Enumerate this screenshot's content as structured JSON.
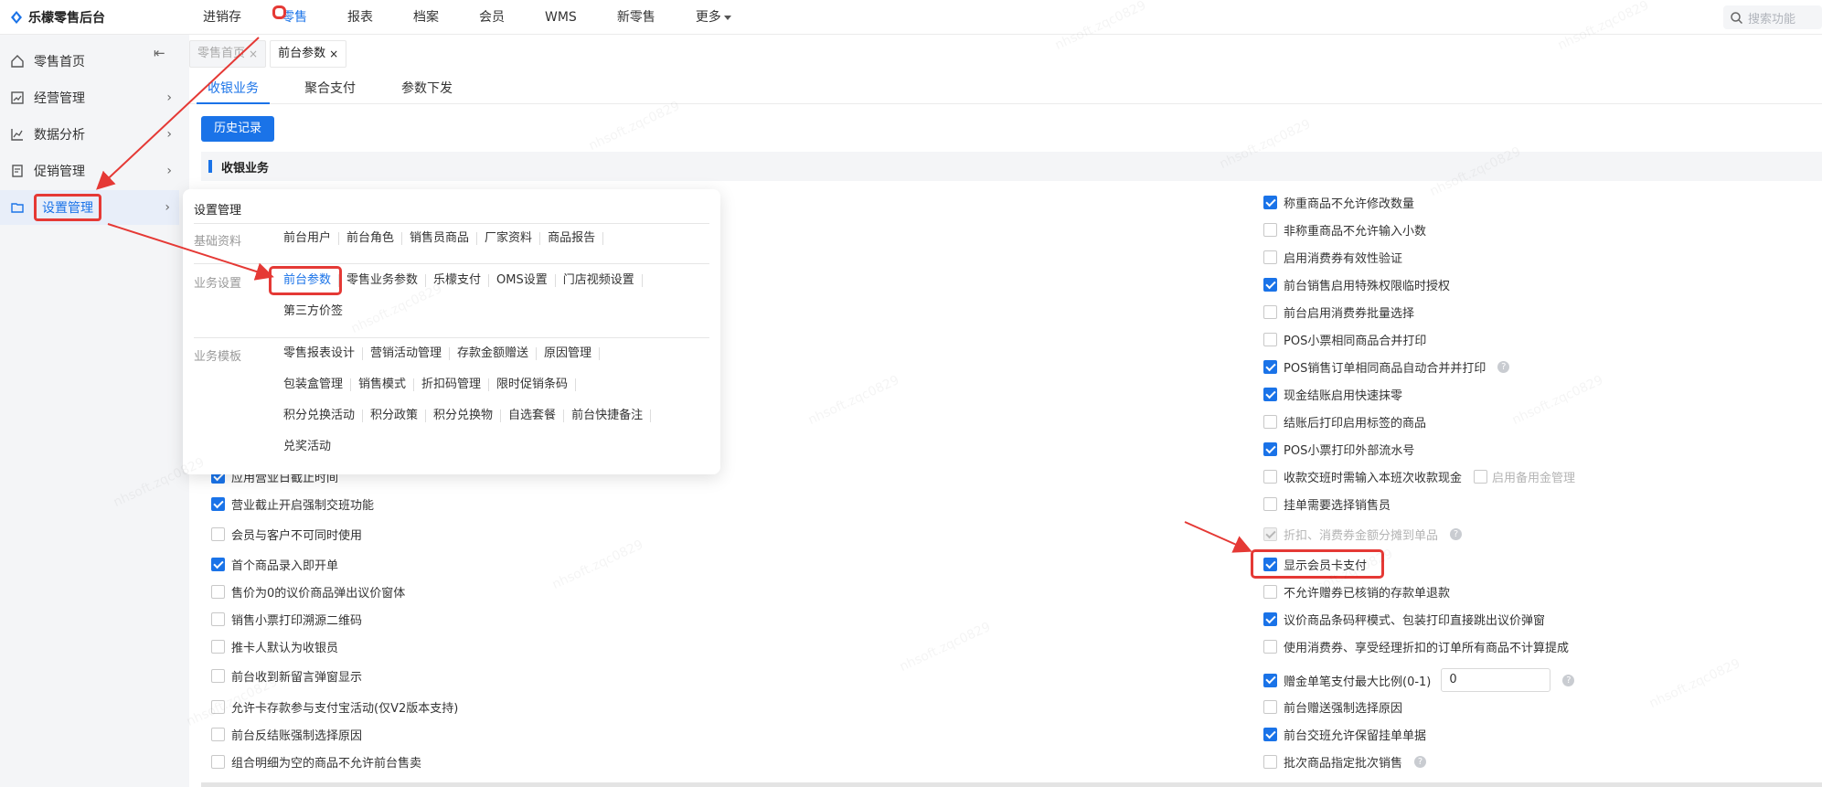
{
  "app": {
    "name": "乐檬零售后台",
    "accent": "#1a73e8",
    "highlight": "#e53935"
  },
  "topnav": {
    "items": [
      "进销存",
      "零售",
      "报表",
      "档案",
      "会员",
      "WMS",
      "新零售",
      "更多"
    ],
    "active_index": 1
  },
  "search": {
    "placeholder": "搜索功能"
  },
  "sidebar": {
    "collapse_glyph": "⇤",
    "items": [
      {
        "label": "零售首页",
        "icon": "home-icon"
      },
      {
        "label": "经营管理",
        "icon": "chart-box-icon"
      },
      {
        "label": "数据分析",
        "icon": "trend-icon"
      },
      {
        "label": "促销管理",
        "icon": "tag-icon"
      },
      {
        "label": "设置管理",
        "icon": "folder-icon"
      }
    ],
    "active_index": 4
  },
  "tabs": [
    {
      "label": "零售首页",
      "active": false
    },
    {
      "label": "前台参数",
      "active": true
    }
  ],
  "subtabs": {
    "items": [
      "收银业务",
      "聚合支付",
      "参数下发"
    ],
    "active_index": 0
  },
  "history_button": "历史记录",
  "section_title": "收银业务",
  "dropdown": {
    "title": "设置管理",
    "groups": [
      {
        "category": "基础资料",
        "rows": [
          [
            "前台用户",
            "前台角色",
            "销售员商品",
            "厂家资料",
            "商品报告"
          ]
        ]
      },
      {
        "category": "业务设置",
        "rows": [
          [
            "前台参数",
            "零售业务参数",
            "乐檬支付",
            "OMS设置",
            "门店视频设置"
          ],
          [
            "第三方价签"
          ]
        ]
      },
      {
        "category": "业务模板",
        "rows": [
          [
            "零售报表设计",
            "营销活动管理",
            "存款金额赠送",
            "原因管理"
          ],
          [
            "包装盒管理",
            "销售模式",
            "折扣码管理",
            "限时促销条码"
          ],
          [
            "积分兑换活动",
            "积分政策",
            "积分兑换物",
            "自选套餐",
            "前台快捷备注"
          ],
          [
            "兑奖活动"
          ]
        ]
      }
    ],
    "selected": "前台参数"
  },
  "left_options": [
    {
      "label": "应用营业日截止时间",
      "checked": true
    },
    {
      "label": "营业截止开启强制交班功能",
      "checked": true
    },
    {
      "label": "会员与客户不可同时使用",
      "checked": false
    },
    {
      "label": "首个商品录入即开单",
      "checked": true
    },
    {
      "label": "售价为0的议价商品弹出议价窗体",
      "checked": false
    },
    {
      "label": "销售小票打印溯源二维码",
      "checked": false
    },
    {
      "label": "推卡人默认为收银员",
      "checked": false
    },
    {
      "label": "前台收到新留言弹窗显示",
      "checked": false
    },
    {
      "label": "允许卡存款参与支付宝活动(仅V2版本支持)",
      "checked": false
    },
    {
      "label": "前台反结账强制选择原因",
      "checked": false
    },
    {
      "label": "组合明细为空的商品不允许前台售卖",
      "checked": false
    }
  ],
  "right_options": [
    {
      "label": "称重商品不允许修改数量",
      "checked": true
    },
    {
      "label": "非称重商品不允许输入小数",
      "checked": false
    },
    {
      "label": "启用消费券有效性验证",
      "checked": false
    },
    {
      "label": "前台销售启用特殊权限临时授权",
      "checked": true
    },
    {
      "label": "前台启用消费券批量选择",
      "checked": false
    },
    {
      "label": "POS小票相同商品合并打印",
      "checked": false
    },
    {
      "label": "POS销售订单相同商品自动合并并打印",
      "checked": true,
      "help": true
    },
    {
      "label": "现金结账启用快速抹零",
      "checked": true
    },
    {
      "label": "结账后打印启用标签的商品",
      "checked": false
    },
    {
      "label": "POS小票打印外部流水号",
      "checked": true
    },
    {
      "label": "收款交班时需输入本班次收款现金",
      "checked": false,
      "extra": "启用备用金管理"
    },
    {
      "label": "挂单需要选择销售员",
      "checked": false
    },
    {
      "label": "折扣、消费券金额分摊到单品",
      "checked": true,
      "disabled": true,
      "help": true
    },
    {
      "label": "显示会员卡支付",
      "checked": true,
      "highlighted": true
    },
    {
      "label": "不允许赠券已核销的存款单退款",
      "checked": false
    },
    {
      "label": "议价商品条码秤模式、包装打印直接跳出议价弹窗",
      "checked": true
    },
    {
      "label": "使用消费券、享受经理折扣的订单所有商品不计算提成",
      "checked": false
    },
    {
      "label": "赠金单笔支付最大比例(0-1)",
      "checked": true,
      "input": "0",
      "help": true
    },
    {
      "label": "前台赠送强制选择原因",
      "checked": false
    },
    {
      "label": "前台交班允许保留挂单单据",
      "checked": true
    },
    {
      "label": "批次商品指定批次销售",
      "checked": false,
      "help": true
    }
  ],
  "watermark": "nhsoft.zqc0829"
}
